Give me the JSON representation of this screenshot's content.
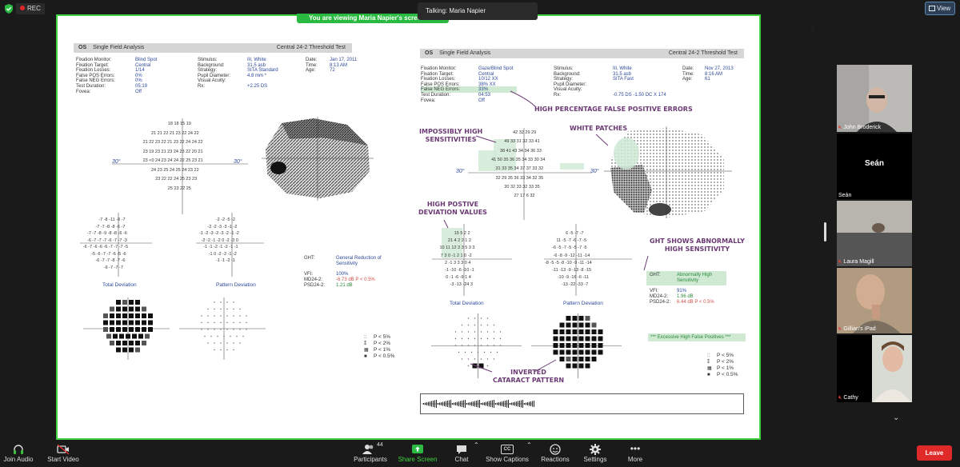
{
  "topbar": {
    "rec_label": "REC",
    "view_label": "View"
  },
  "share": {
    "banner": "You are viewing  Maria Napier's screen",
    "talking": "Talking: Maria Napier"
  },
  "report_left": {
    "eye": "OS",
    "analysis": "Single Field Analysis",
    "test": "Central 24-2 Threshold Test",
    "fields": [
      {
        "label": "Fixation Monitor:",
        "value": "Blind Spot"
      },
      {
        "label": "Fixation Target:",
        "value": "Central"
      },
      {
        "label": "Fixation Losses:",
        "value": "1/14"
      },
      {
        "label": "False POS Errors:",
        "value": "0%"
      },
      {
        "label": "False NEG Errors:",
        "value": "0%"
      },
      {
        "label": "Test Duration:",
        "value": "05:19"
      },
      {
        "label": "Fovea:",
        "value": "Off"
      }
    ],
    "fields2": [
      {
        "label": "Stimulus:",
        "value": "III, White"
      },
      {
        "label": "Background:",
        "value": "31.5 asb"
      },
      {
        "label": "Strategy:",
        "value": "SITA Standard"
      },
      {
        "label": "Pupil Diameter:",
        "value": "4.8 mm *"
      },
      {
        "label": "Visual Acuity:",
        "value": ""
      },
      {
        "label": "Rx:",
        "value": "+2.25 DS"
      }
    ],
    "fields3": [
      {
        "label": "Date:",
        "value": "Jan 17, 2011"
      },
      {
        "label": "Time:",
        "value": "8:13 AM"
      },
      {
        "label": "Age:",
        "value": "72"
      }
    ],
    "sens_rows": [
      "18  18  15  19",
      "21  21  22  21  23  22  24  22",
      "21  22  23  22  21  23  22  24  24  22",
      "23  19  23  21  23  24  23  22  20  21",
      "23  <0  24  23  24  24  22  25  23  21",
      "24  23  25  24  25  24  23  22",
      "23  22  22  24  25  23  23",
      "25  23  22  25"
    ],
    "axis": "30°",
    "td_rows": [
      "-7  -8  -11  -8  -7",
      "-7  -7  -8  -8  -6  -7",
      "-7  -7  -8  -9  -8  -8  -6  -6",
      "-6  -7  -7  -7  -6  -7  -7  -3",
      "-6  -7  -6  -6  -6  -7  -7  -7  -5",
      "-5  -6  -7  -7  -6  -5  -6",
      "-6  -7  -7  -8  -7  -6",
      "-6  -7  -7  -7"
    ],
    "pd_rows": [
      "-2  -2  -5  -2",
      "-2  -2  -3  -3  -1  -2",
      "-1  -2  -3  -2  -3  -2  -1  -2",
      "-2  -2  -1  -2  0  -2  -3  0",
      "-1  -1  -2  -1  -2  -1  -1",
      "-1  0  -2  -2  -1  -2",
      "-1  -1  -2  -1"
    ],
    "td_caption": "Total Deviation",
    "pd_caption": "Pattern Deviation",
    "ght_label": "GHT:",
    "ght_value": "General Reduction of Sensitivity",
    "vfi_label": "VFI:",
    "vfi_value": "100%",
    "md_label": "MD24-2:",
    "md_value": "-6.73 dB P < 0.5%",
    "psd_label": "PSD24-2:",
    "psd_value": "1.21 dB",
    "legend": [
      {
        "sym": "::",
        "text": "P < 5%"
      },
      {
        "sym": "⁑",
        "text": "P < 2%"
      },
      {
        "sym": "▦",
        "text": "P < 1%"
      },
      {
        "sym": "■",
        "text": "P < 0.5%"
      }
    ]
  },
  "report_right": {
    "eye": "OS",
    "analysis": "Single Field Analysis",
    "test": "Central 24-2 Threshold Test",
    "fields": [
      {
        "label": "Fixation Monitor:",
        "value": "Gaze/Blind Spot"
      },
      {
        "label": "Fixation Target:",
        "value": "Central"
      },
      {
        "label": "Fixation Losses:",
        "value": "10/12 XX"
      },
      {
        "label": "False POS Errors:",
        "value": "38% XX"
      },
      {
        "label": "False NEG Errors:",
        "value": "33%"
      },
      {
        "label": "Test Duration:",
        "value": "04:53"
      },
      {
        "label": "Fovea:",
        "value": "Off"
      }
    ],
    "fields2": [
      {
        "label": "Stimulus:",
        "value": "III, White"
      },
      {
        "label": "Background:",
        "value": "31.5 asb"
      },
      {
        "label": "Strategy:",
        "value": "SITA Fast"
      },
      {
        "label": "Pupil Diameter:",
        "value": ""
      },
      {
        "label": "Visual Acuity:",
        "value": ""
      },
      {
        "label": "Rx:",
        "value": "-0.75 DS  -1.50 DC  X 174"
      }
    ],
    "fields3": [
      {
        "label": "Date:",
        "value": "Nov 27, 2013"
      },
      {
        "label": "Time:",
        "value": "8:16 AM"
      },
      {
        "label": "Age:",
        "value": "61"
      }
    ],
    "sens_rows": [
      "42  32  29  29",
      "49  33  31  32  33  41",
      "38  41  43  34  34  36  33",
      "41  50  35  36  35  34  33  30  34",
      "31  33  35  34  37  37  33  32",
      "32  29  35  36  33  34  32  35",
      "30  32  33  32  33  35",
      "27  17  6  32"
    ],
    "axis": "30°",
    "td_rows": [
      "15  5  2  2",
      "21  4  2  2  1  2",
      "10  11  12  3  3  5  3  3",
      "7  3  0  -1  2  1  0  -2",
      "2  -1  3  3  3  0  4",
      "-1  -10  -6  -10  -1",
      "0  -1  -6  -9  1  4",
      "-3  -13  -24  3"
    ],
    "pd_rows": [
      "6  -5  -7  -7",
      "11  -5  -7  -6  -7  -5",
      "-6  -5  -7  -5  -5  -7  -5",
      "-6  -8  -9  -12  -11  -14",
      "-8  -5  -5  -8  -10  -9  -11  -14",
      "-11  -13  -9  -13  -8  -15",
      "-10  -9  -16  -6  -11",
      "-13  -22  -33  -7"
    ],
    "td_caption": "Total Deviation",
    "pd_caption": "Pattern Deviation",
    "ght_label": "GHT:",
    "ght_value": "Abnormally High Sensitivity",
    "vfi_label": "VFI:",
    "vfi_value": "91%",
    "md_label": "MD24-2:",
    "md_value": "1.96 dB",
    "psd_label": "PSD24-2:",
    "psd_value": "6.44 dB P < 0.5%",
    "excessive": "*** Excessive High False Positives ***",
    "legend": [
      {
        "sym": "::",
        "text": "P < 5%"
      },
      {
        "sym": "⁑",
        "text": "P < 2%"
      },
      {
        "sym": "▦",
        "text": "P < 1%"
      },
      {
        "sym": "■",
        "text": "P < 0.5%"
      }
    ]
  },
  "annotations": {
    "high_fp": "HIGH PERCENTAGE FALSE POSITIVE ERRORS",
    "impossibly": "IMPOSSIBLY HIGH\nSENSITIVITIES",
    "white_patches": "WHITE PATCHES",
    "high_pos_dev": "HIGH POSTIVE\nDEVIATION VALUES",
    "ght_shows": "GHT SHOWS ABNORMALLY\nHIGH SENSITIVITY",
    "inverted": "INVERTED\nCATARACT PATTERN"
  },
  "participants": [
    {
      "name": "John Broderick",
      "muted": true
    },
    {
      "name": "Seán",
      "display": "Seán",
      "muted": false
    },
    {
      "name": "Laura Magill",
      "muted": true
    },
    {
      "name": "Gillian's iPad",
      "muted": true
    },
    {
      "name": "Cathy",
      "muted": true
    }
  ],
  "toolbar": {
    "join_audio": "Join Audio",
    "start_video": "Start Video",
    "participants": "Participants",
    "participants_count": "44",
    "share_screen": "Share Screen",
    "chat": "Chat",
    "captions": "Show Captions",
    "captions_icon": "CC",
    "reactions": "Reactions",
    "settings": "Settings",
    "more": "More",
    "leave": "Leave"
  },
  "colors": {
    "share_border": "#3fd43f",
    "banner": "#2bba41",
    "leave": "#e02a2a",
    "annotation": "#6b3a74",
    "report_blue": "#2e4a9a",
    "highlight": "#cfe9d3"
  }
}
